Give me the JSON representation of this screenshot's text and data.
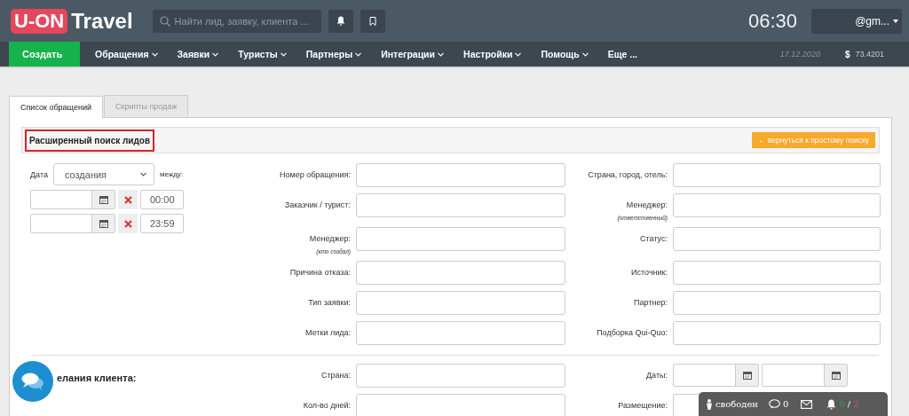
{
  "header": {
    "logo": {
      "badge": "U-ON",
      "text": "Travel"
    },
    "search": {
      "placeholder": "Найти лид, заявку, клиента ..."
    },
    "time": "06:30",
    "user": "@gm..."
  },
  "nav": {
    "create": "Создать",
    "items": [
      {
        "label": "Обращения",
        "dropdown": true
      },
      {
        "label": "Заявки",
        "dropdown": true
      },
      {
        "label": "Туристы",
        "dropdown": true
      },
      {
        "label": "Партнеры",
        "dropdown": true
      },
      {
        "label": "Интеграции",
        "dropdown": true
      },
      {
        "label": "Настройки",
        "dropdown": true
      },
      {
        "label": "Помощь",
        "dropdown": true
      },
      {
        "label": "Еще ...",
        "dropdown": false
      }
    ],
    "date": "17.12.2020",
    "currency": "$",
    "rate": "73.4201"
  },
  "tabs": [
    {
      "label": "Список обращений",
      "selected": true
    },
    {
      "label": "Скрипты продаж",
      "selected": false
    }
  ],
  "panel": {
    "title": "Расширенный поиск лидов",
    "back_button": "← вернуться к простому поиску",
    "date_filter": {
      "label": "Дата",
      "select": "создания",
      "between": "между:",
      "rows": [
        {
          "time": "00:00"
        },
        {
          "time": "23:59"
        }
      ]
    },
    "rows": [
      {
        "left": {
          "label": "Номер обращения:"
        },
        "right": {
          "label": "Страна, город, отель:",
          "kind": "text"
        }
      },
      {
        "left": {
          "label": "Заказчик / турист:"
        },
        "right": {
          "label": "Менеджер:",
          "note": "(ответственный)",
          "kind": "text"
        }
      },
      {
        "left": {
          "label": "Менеджер:",
          "note": "(кто создал)"
        },
        "right": {
          "label": "Статус:",
          "kind": "text"
        }
      },
      {
        "left": {
          "label": "Причина отказа:"
        },
        "right": {
          "label": "Источник:",
          "kind": "text"
        }
      },
      {
        "left": {
          "label": "Тип заявки:"
        },
        "right": {
          "label": "Партнер:",
          "kind": "text"
        }
      },
      {
        "left": {
          "label": "Метки лида:"
        },
        "right": {
          "label": "Подборка Qui-Quo:",
          "kind": "text"
        }
      }
    ],
    "wishes": {
      "title": "елания клиента:",
      "rows": [
        {
          "left": {
            "label": "Страна:"
          },
          "right": {
            "label": "Даты:",
            "kind": "dates"
          }
        },
        {
          "left": {
            "label": "Кол-во дней:"
          },
          "right": {
            "label": "Размещение:",
            "kind": "text"
          }
        }
      ]
    }
  },
  "status_widget": {
    "status": "свободен",
    "messages": "0",
    "ok": "0",
    "separator": "/",
    "total": "2"
  }
}
